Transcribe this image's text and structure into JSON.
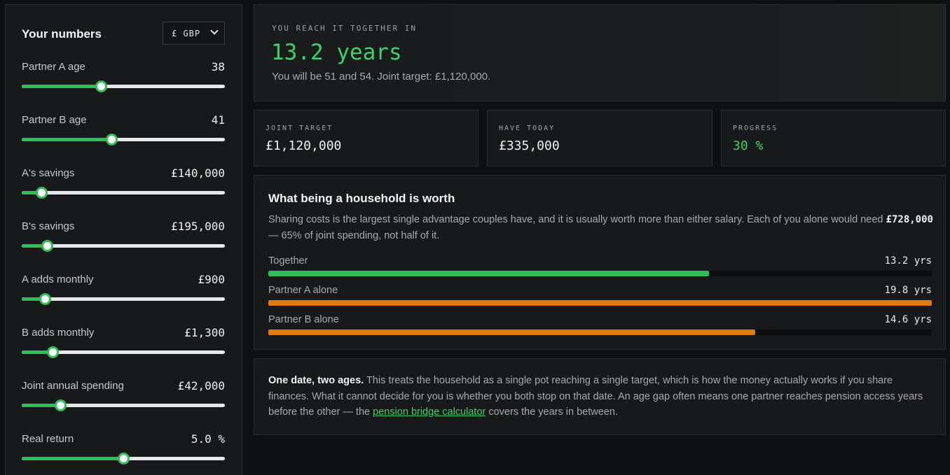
{
  "sidebar": {
    "title": "Your numbers",
    "currency": "£ GBP",
    "sliders": [
      {
        "label": "Partner A age",
        "value": "38",
        "fraction": 0.39
      },
      {
        "label": "Partner B age",
        "value": "41",
        "fraction": 0.44
      },
      {
        "label": "A's savings",
        "value": "£140,000",
        "fraction": 0.095
      },
      {
        "label": "B's savings",
        "value": "£195,000",
        "fraction": 0.125
      },
      {
        "label": "A adds monthly",
        "value": "£900",
        "fraction": 0.115
      },
      {
        "label": "B adds monthly",
        "value": "£1,300",
        "fraction": 0.15
      },
      {
        "label": "Joint annual spending",
        "value": "£42,000",
        "fraction": 0.19
      },
      {
        "label": "Real return",
        "value": "5.0 %",
        "fraction": 0.5
      }
    ]
  },
  "hero": {
    "eyebrow": "YOU REACH IT TOGETHER IN",
    "headline": "13.2 years",
    "subline": "You will be 51 and 54. Joint target: £1,120,000."
  },
  "stats": [
    {
      "label": "JOINT TARGET",
      "value": "£1,120,000"
    },
    {
      "label": "HAVE TODAY",
      "value": "£335,000"
    },
    {
      "label": "PROGRESS",
      "value": "30 %"
    }
  ],
  "household": {
    "title": "What being a household is worth",
    "desc_before": "Sharing costs is the largest single advantage couples have, and it is usually worth more than either salary. Each of you alone would need ",
    "desc_amount": "£728,000",
    "desc_after": " — 65% of joint spending, not half of it.",
    "bars": [
      {
        "label": "Together",
        "value": "13.2 yrs",
        "fraction": 0.664,
        "color": "#2fbf57"
      },
      {
        "label": "Partner A alone",
        "value": "19.8 yrs",
        "fraction": 1.0,
        "color": "#e07b0e"
      },
      {
        "label": "Partner B alone",
        "value": "14.6 yrs",
        "fraction": 0.734,
        "color": "#e07b0e"
      }
    ]
  },
  "note": {
    "lead": "One date, two ages.",
    "body_before": " This treats the household as a single pot reaching a single target, which is how the money actually works if you share finances. What it cannot decide for you is whether you both stop on that date. An age gap often means one partner reaches pension access years before the other — the ",
    "link": "pension bridge calculator",
    "body_after": " covers the years in between."
  }
}
